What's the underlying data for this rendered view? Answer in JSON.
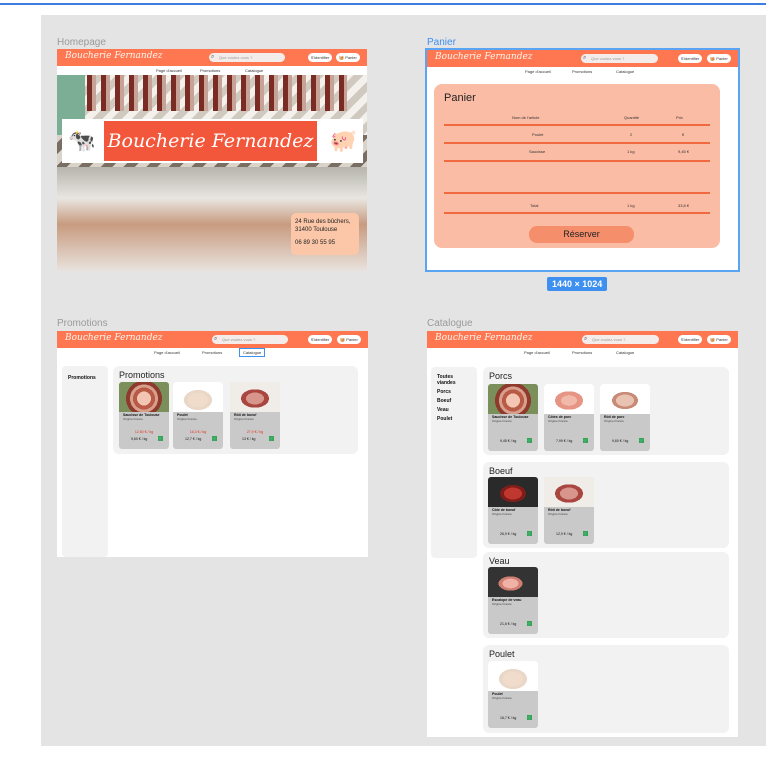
{
  "frames": {
    "homepage": {
      "label": "Homepage"
    },
    "panier": {
      "label": "Panier",
      "size_badge": "1440 × 1024"
    },
    "promotions": {
      "label": "Promotions"
    },
    "catalogue": {
      "label": "Catalogue"
    }
  },
  "app": {
    "brand": "Boucherie Fernandez",
    "search_placeholder": "Que voulez-vous ?",
    "identifier_label": "S'identifier",
    "panier_label": "Panier",
    "nav": [
      "Page d'accueil",
      "Promotions",
      "Catalogue"
    ]
  },
  "homepage": {
    "banner_title": "Boucherie Fernandez",
    "address_line1": "24 Rue des bûchers,",
    "address_line2": "31400 Toulouse",
    "phone": "06 89 30 55 95"
  },
  "panier": {
    "title": "Panier",
    "headers": [
      "Nom de l'article",
      "Quantité",
      "Prix"
    ],
    "rows": [
      {
        "name": "Poulet",
        "qty": "2",
        "price": "€"
      },
      {
        "name": "Saucisse",
        "qty": "1 kg",
        "price": "9,45 €"
      }
    ],
    "total": {
      "label": "Total",
      "qty": "1 kg",
      "price": "33,8 €"
    },
    "reserve_button": "Réserver"
  },
  "promotions_page": {
    "side_item": "Promotions",
    "section_title": "Promotions",
    "cards": [
      {
        "name": "Saucisse de Toulouse",
        "origin": "Origine France",
        "old": "12,60 € / kg",
        "price": "9,60 € / kg"
      },
      {
        "name": "Poulet",
        "origin": "Origine France",
        "old": "16,3 € / kg",
        "price": "12,7 € / kg"
      },
      {
        "name": "Rôti de boeuf",
        "origin": "Origine France",
        "old": "27,9 € / kg",
        "price": "13 € / kg"
      }
    ]
  },
  "catalogue_page": {
    "side_items": [
      "Toutes viandes",
      "Porcs",
      "Boeuf",
      "Veau",
      "Poulet"
    ],
    "sections": [
      {
        "title": "Porcs",
        "cards": [
          {
            "name": "Saucisse de Toulouse",
            "origin": "Origine France",
            "price": "9,45 € / kg"
          },
          {
            "name": "Côtes de porc",
            "origin": "Origine France",
            "price": "7,99 € / kg"
          },
          {
            "name": "Rôti de porc",
            "origin": "Origine France",
            "price": "9,60 € / kg"
          }
        ]
      },
      {
        "title": "Boeuf",
        "cards": [
          {
            "name": "Côte de boeuf",
            "origin": "Origine France",
            "price": "26,9 € / kg"
          },
          {
            "name": "Rôti de boeuf",
            "origin": "Origine France",
            "price": "12,9 € / kg"
          }
        ]
      },
      {
        "title": "Veau",
        "cards": [
          {
            "name": "Escalope de veau",
            "origin": "Origine France",
            "price": "21,6 € / kg"
          }
        ]
      },
      {
        "title": "Poulet",
        "cards": [
          {
            "name": "Poulet",
            "origin": "Origine France",
            "price": "16,7 € / kg"
          }
        ]
      }
    ]
  },
  "colors": {
    "accent": "#ff7751",
    "selection": "#3d8ff0",
    "cart_bg": "#fbbca5"
  }
}
